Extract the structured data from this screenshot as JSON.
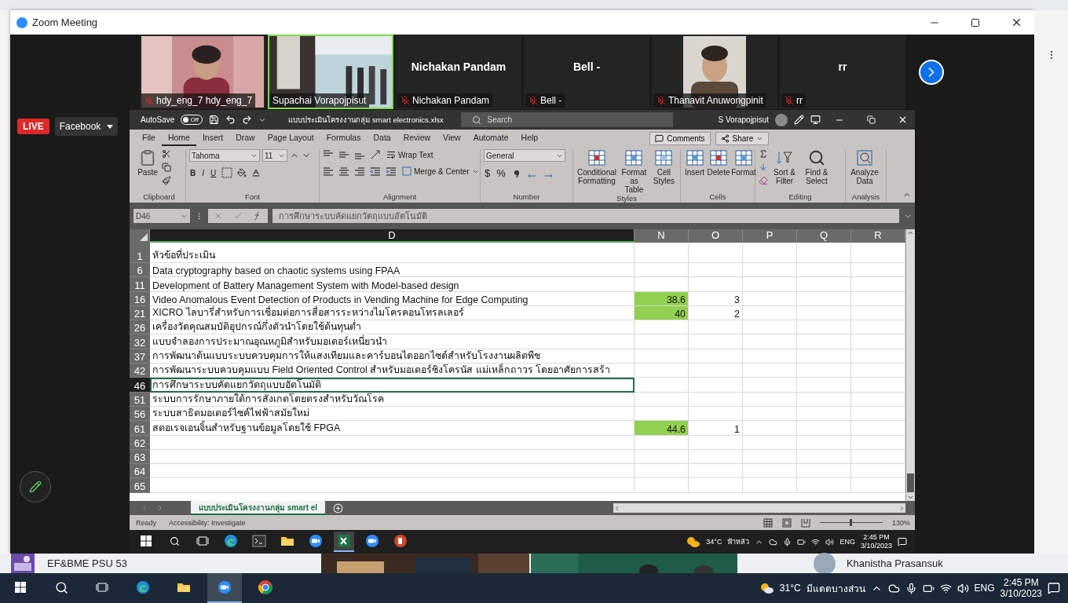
{
  "zoom": {
    "title": "Zoom Meeting"
  },
  "participants": [
    {
      "kind": "video",
      "label": "hdy_eng_7 hdy_eng_7",
      "muted": true,
      "speaking": false
    },
    {
      "kind": "video",
      "label": "Supachai Vorapojpisut",
      "muted": false,
      "speaking": true
    },
    {
      "kind": "name",
      "display": "Nichakan Pandam",
      "label": "Nichakan Pandam",
      "muted": true,
      "speaking": false
    },
    {
      "kind": "name",
      "display": "Bell -",
      "label": "Bell -",
      "muted": true,
      "speaking": false
    },
    {
      "kind": "avatar",
      "label": "Thanavit Anuwongpinit",
      "muted": true,
      "speaking": false
    },
    {
      "kind": "name",
      "display": "rr",
      "label": "rr",
      "muted": true,
      "speaking": false
    }
  ],
  "live": {
    "badge": "LIVE",
    "platform": "Facebook"
  },
  "excel": {
    "title_bar": {
      "autosave": "AutoSave",
      "toggle": "Off",
      "autosave_on": false,
      "file": "แบบประเมินโครงงานกลุ่ม smart electronics.xlsx",
      "search": "Search",
      "user": "S Vorapojpisut"
    },
    "tabs": [
      {
        "label": "File",
        "selected": false
      },
      {
        "label": "Home",
        "selected": true
      },
      {
        "label": "Insert",
        "selected": false
      },
      {
        "label": "Draw",
        "selected": false
      },
      {
        "label": "Page Layout",
        "selected": false
      },
      {
        "label": "Formulas",
        "selected": false
      },
      {
        "label": "Data",
        "selected": false
      },
      {
        "label": "Review",
        "selected": false
      },
      {
        "label": "View",
        "selected": false
      },
      {
        "label": "Automate",
        "selected": false
      },
      {
        "label": "Help",
        "selected": false
      }
    ],
    "comments": "Comments",
    "share": "Share",
    "ribbon": {
      "clipboard": {
        "label": "Clipboard",
        "paste": "Paste"
      },
      "font": {
        "label": "Font",
        "face": "Tahoma",
        "size": "11",
        "bold": "B",
        "italic": "I",
        "underline": "U"
      },
      "alignment": {
        "label": "Alignment",
        "wrap": "Wrap Text",
        "merge": "Merge & Center"
      },
      "number": {
        "label": "Number",
        "format": "General",
        "currency": "$",
        "percent": "%"
      },
      "styles": {
        "label": "Styles",
        "conditional": "Conditional Formatting",
        "table": "Format as Table",
        "cell": "Cell Styles"
      },
      "cells": {
        "label": "Cells",
        "insert": "Insert",
        "delete": "Delete",
        "format": "Format"
      },
      "editing": {
        "label": "Editing",
        "sort": "Sort & Filter",
        "find": "Find & Select"
      },
      "analysis": {
        "label": "Analysis",
        "analyze": "Analyze Data"
      }
    },
    "name_box": "D46",
    "formula": "การศึกษาระบบคัดแยกวัตถุแบบอัตโนมัติ",
    "columns": [
      {
        "label": "D",
        "selected": true
      },
      {
        "label": "N",
        "selected": false
      },
      {
        "label": "O",
        "selected": false
      },
      {
        "label": "P",
        "selected": false
      },
      {
        "label": "Q",
        "selected": false
      },
      {
        "label": "R",
        "selected": false
      }
    ],
    "rows": [
      {
        "num": "1",
        "d": "หัวข้อที่ประเมิน",
        "filled": false,
        "selected": false
      },
      {
        "num": "6",
        "d": "Data cryptography based on chaotic systems using FPAA",
        "filled": false,
        "selected": false
      },
      {
        "num": "11",
        "d": "Development of Battery Management System with Model-based design",
        "filled": false,
        "selected": false
      },
      {
        "num": "16",
        "d": "Video Anomalous Event Detection of Products in Vending Machine for Edge Computing",
        "n": "38.6",
        "o": "3",
        "filled": true,
        "selected": false
      },
      {
        "num": "21",
        "d": "XICRO ไลบารี่สำหรับการเชื่อมต่อการสื่อสารระหว่างไมโครคอนโทรลเลอร์",
        "n": "40",
        "o": "2",
        "filled": true,
        "selected": false
      },
      {
        "num": "26",
        "d": "เครื่องวัดคุณสมบัติอุปกรณ์กึ่งตัวนำโดยใช้ต้นทุนต่ำ",
        "filled": false,
        "selected": false
      },
      {
        "num": "32",
        "d": "แบบจำลองการประมาณอุณหภูมิสำหรับมอเตอร์เหนี่ยวนำ",
        "filled": false,
        "selected": false
      },
      {
        "num": "37",
        "d": "การพัฒนาต้นแบบระบบควบคุมการให้แสงเทียมและคาร์บอนไดออกไซด์สำหรับโรงงานผลิตพืช",
        "filled": false,
        "selected": false
      },
      {
        "num": "42",
        "d": "การพัฒนาระบบควบคุมแบบ Field Oriented Control สำหรับมอเตอร์ซิงโครนัส แม่เหล็กถาวร โดยอาศัยการสร้า",
        "filled": false,
        "selected": false
      },
      {
        "num": "46",
        "d": "การศึกษาระบบคัดแยกวัตถุแบบอัตโนมัติ",
        "filled": false,
        "selected": true
      },
      {
        "num": "51",
        "d": "ระบบการรักษาภายใต้การสังเกตโดยตรงสำหรับวัณโรค",
        "filled": false,
        "selected": false
      },
      {
        "num": "56",
        "d": "ระบบสาธิตมอเตอร์ไซค์ไฟฟ้าสมัยใหม่",
        "filled": false,
        "selected": false
      },
      {
        "num": "61",
        "d": "สตอเรจเอนจิ้นสำหรับฐานข้อมูลโดยใช้ FPGA",
        "n": "44.6",
        "o": "1",
        "filled": true,
        "selected": false
      },
      {
        "num": "62",
        "filled": false,
        "selected": false
      },
      {
        "num": "63",
        "filled": false,
        "selected": false
      },
      {
        "num": "64",
        "filled": false,
        "selected": false
      },
      {
        "num": "65",
        "filled": false,
        "selected": false
      }
    ],
    "sheet_tab": "แบบประเมินโครงงานกลุ่ม smart el",
    "status": {
      "ready": "Ready",
      "accessibility": "Accessibility: Investigate",
      "zoom": "130%",
      "zoom_slider": {
        "level": 0.5
      }
    }
  },
  "remote_taskbar": {
    "apps": [
      {
        "kind": "edge",
        "active": false
      },
      {
        "kind": "terminal",
        "active": false
      },
      {
        "kind": "folder",
        "active": false
      },
      {
        "kind": "zoom",
        "active": false
      },
      {
        "kind": "excel",
        "active": true
      },
      {
        "kind": "zoom",
        "active": false
      },
      {
        "kind": "powerpoint",
        "active": false
      }
    ],
    "temp": "34°C",
    "condition": "ฟ้าหลัว",
    "lang": "ENG",
    "time": "2:45 PM",
    "date": "3/10/2023"
  },
  "background": {
    "left_label": "EF&BME PSU 53",
    "right_name": "Khanistha Prasansuk"
  },
  "taskbar": {
    "apps": [
      {
        "kind": "edge",
        "active": false
      },
      {
        "kind": "folder",
        "active": false
      },
      {
        "kind": "zoom",
        "active": true
      },
      {
        "kind": "chrome",
        "active": false
      }
    ],
    "temp": "31°C",
    "condition": "มีแดดบางส่วน",
    "lang": "ENG",
    "time": "2:45 PM",
    "date": "3/10/2023"
  }
}
